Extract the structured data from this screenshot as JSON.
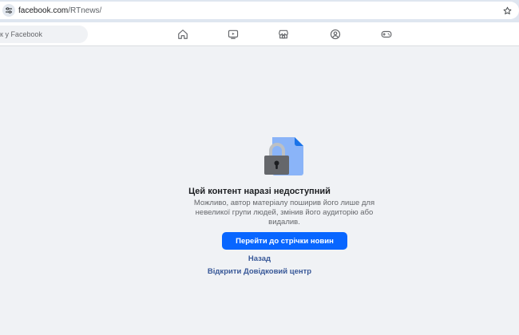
{
  "browser": {
    "url_host": "facebook.com",
    "url_path": "/RTnews/",
    "icons": {
      "site_info": "tune-icon",
      "bookmark": "star-icon"
    }
  },
  "topbar": {
    "search_placeholder": "к у Facebook",
    "nav_icons": [
      "home-icon",
      "video-icon",
      "marketplace-icon",
      "groups-icon",
      "gaming-icon"
    ]
  },
  "content": {
    "title": "Цей контент наразі недоступний",
    "body": "Можливо, автор матеріалу поширив його лише для невеликої групи людей, змінив його аудиторію або видалив.",
    "primary_button": "Перейти до стрічки новин",
    "back_link": "Назад",
    "help_link": "Відкрити Довідковий центр"
  },
  "colors": {
    "accent": "#0866ff",
    "link": "#385898",
    "background": "#f0f2f5",
    "document_blue": "#8ab4f8",
    "lock_gray": "#65676b"
  }
}
